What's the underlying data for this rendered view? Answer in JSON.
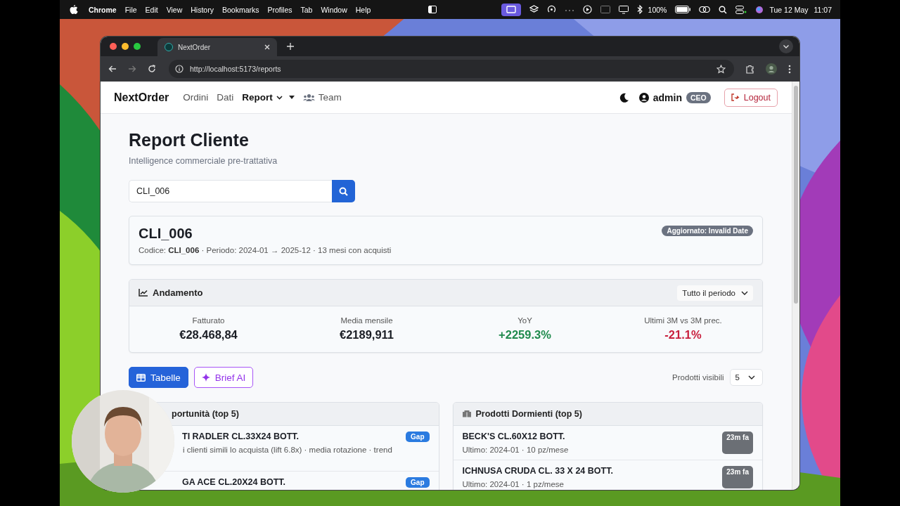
{
  "menubar": {
    "app": "Chrome",
    "menus": [
      "File",
      "Edit",
      "View",
      "History",
      "Bookmarks",
      "Profiles",
      "Tab",
      "Window",
      "Help"
    ],
    "battery": "100%",
    "date": "Tue 12 May",
    "time": "11:07"
  },
  "browser": {
    "tab_title": "NextOrder",
    "url": "http://localhost:5173/reports"
  },
  "navbar": {
    "brand": "NextOrder",
    "links": [
      {
        "label": "Ordini",
        "selected": false,
        "kind": "plain"
      },
      {
        "label": "Dati",
        "selected": false,
        "kind": "plain"
      },
      {
        "label": "Report",
        "selected": true,
        "kind": "dropdown"
      },
      {
        "label": "Team",
        "selected": false,
        "kind": "team"
      }
    ],
    "user": "admin",
    "role": "CEO",
    "logout": "Logout"
  },
  "page": {
    "title": "Report Cliente",
    "subtitle": "Intelligence commerciale pre-trattativa",
    "search": {
      "value": "CLI_006"
    }
  },
  "client": {
    "name": "CLI_006",
    "details": "Codice: **CLI_006** · Periodo: 2024-01 → 2025-12 · 13 mesi con acquisti",
    "badge": "Aggiornato: Invalid Date"
  },
  "trend": {
    "title": "Andamento",
    "period": "Tutto il periodo",
    "metrics": [
      {
        "label": "Fatturato",
        "value": "€28.468,84",
        "color": "#1a1d24"
      },
      {
        "label": "Media mensile",
        "value": "€2189,911",
        "color": "#1a1d24"
      },
      {
        "label": "YoY",
        "value": "+2259.3%",
        "color": "#1f8a4c"
      },
      {
        "label": "Ultimi 3M vs 3M prec.",
        "value": "-21.1%",
        "color": "#c81e3c"
      }
    ]
  },
  "views": [
    {
      "label": "Tabelle",
      "selected": true,
      "kind": "table"
    },
    {
      "label": "Brief AI",
      "selected": false,
      "kind": "ai"
    }
  ],
  "visible_products": {
    "label": "Prodotti visibili",
    "value": "5"
  },
  "panels": [
    {
      "title": "portunità (top 5)",
      "kind": "opportunity",
      "items": [
        {
          "name": "TI RADLER CL.33X24 BOTT.",
          "detail": "i clienti simili lo acquista (lift 6.8x) · media rotazione · trend",
          "badge": "Gap",
          "color": "#2b7be0"
        },
        {
          "name": "GA ACE CL.20X24 BOTT.",
          "badge": "Gap",
          "color": "#2b7be0"
        }
      ]
    },
    {
      "title": "Prodotti Dormienti (top 5)",
      "kind": "dormant",
      "items": [
        {
          "name": "BECK'S CL.60X12 BOTT.",
          "detail": "Ultimo: 2024-01 · 10 pz/mese",
          "badge": "23m fa",
          "color": "#6b6f75"
        },
        {
          "name": "ICHNUSA CRUDA CL. 33 X 24 BOTT.",
          "detail": "Ultimo: 2024-01 · 1 pz/mese",
          "badge": "23m fa",
          "color": "#6b6f75"
        }
      ]
    }
  ]
}
